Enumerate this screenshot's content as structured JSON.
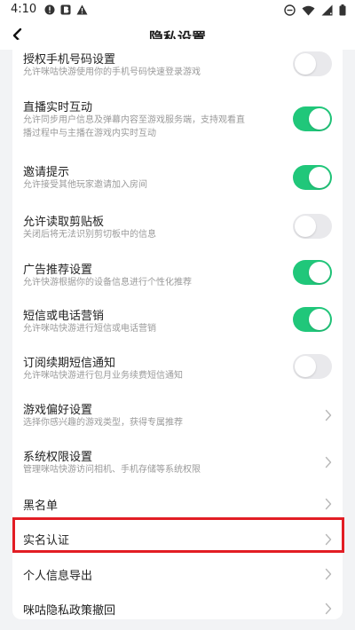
{
  "status_bar": {
    "time": "4:10"
  },
  "nav": {
    "title": "隐私设置"
  },
  "settings": [
    {
      "title": "授权手机号码设置",
      "desc": "允许咪咕快游使用你的手机号码快速登录游戏",
      "toggle": false
    },
    {
      "title": "直播实时互动",
      "desc": "允许同步用户信息及弹幕内容至游戏服务端，支持观看直",
      "desc2": "播过程中与主播在游戏内实时互动",
      "toggle": true
    },
    {
      "title": "邀请提示",
      "desc": "允许接受其他玩家邀请加入房间",
      "toggle": true
    },
    {
      "title": "允许读取剪贴板",
      "desc": "关闭后将无法识别剪切板中的信息",
      "toggle": false
    },
    {
      "title": "广告推荐设置",
      "desc": "允许快游根据你的设备信息进行个性化推荐",
      "toggle": true
    },
    {
      "title": "短信或电话营销",
      "desc": "允许咪咕快游进行短信或电话营销",
      "toggle": true
    },
    {
      "title": "订阅续期短信通知",
      "desc": "允许咪咕快游进行包月业务续费短信通知",
      "toggle": false
    },
    {
      "title": "游戏偏好设置",
      "desc": "选择你感兴趣的游戏类型，获得专属推荐"
    },
    {
      "title": "系统权限设置",
      "desc": "管理咪咕快游访问相机、手机存储等系统权限"
    },
    {
      "title": "黑名单"
    },
    {
      "title": "实名认证"
    },
    {
      "title": "个人信息导出"
    },
    {
      "title": "咪咕隐私政策撤回"
    }
  ],
  "colors": {
    "toggle_on": "#20c77a",
    "toggle_off": "#e9e9ec",
    "highlight": "#e21d24"
  },
  "icons": [
    "alert-icon",
    "b-icon",
    "warning-icon",
    "dnd-icon",
    "wifi-icon",
    "signal-icon",
    "battery-icon",
    "back-arrow-icon",
    "chevron-right-icon"
  ]
}
